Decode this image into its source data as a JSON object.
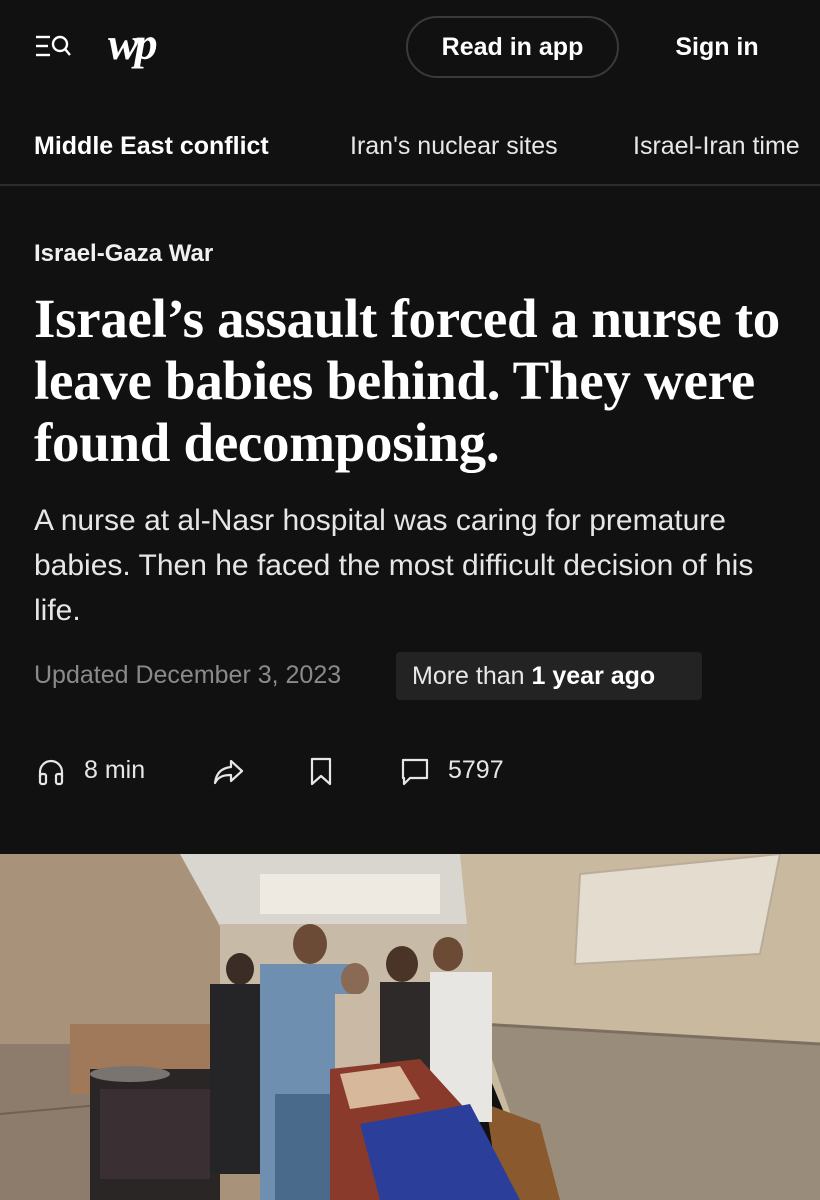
{
  "header": {
    "logo_text": "wp",
    "read_in_app_label": "Read in app",
    "sign_in_label": "Sign in"
  },
  "topics": [
    {
      "label": "Middle East conflict"
    },
    {
      "label": "Iran's nuclear sites"
    },
    {
      "label": "Israel-Iran time"
    }
  ],
  "article": {
    "kicker": "Israel-Gaza War",
    "headline": "Israel’s assault forced a nurse to leave babies behind. They were found decomposing.",
    "dek": "A nurse at al-Nasr hospital was caring for premature babies. Then he faced the most difficult decision of his life.",
    "updated": "Updated December 3, 2023",
    "age_prefix": "More than ",
    "age_bold": "1 year ago"
  },
  "actions": {
    "listen_label": "8 min",
    "comments_count": "5797"
  },
  "icons": {
    "menu": "menu-search-icon",
    "listen": "headphones-icon",
    "share": "share-arrow-icon",
    "save": "bookmark-icon",
    "comments": "comment-icon"
  },
  "colors": {
    "background": "#111111",
    "text": "#ffffff",
    "muted": "#8a8a8a",
    "badge": "#232323"
  }
}
